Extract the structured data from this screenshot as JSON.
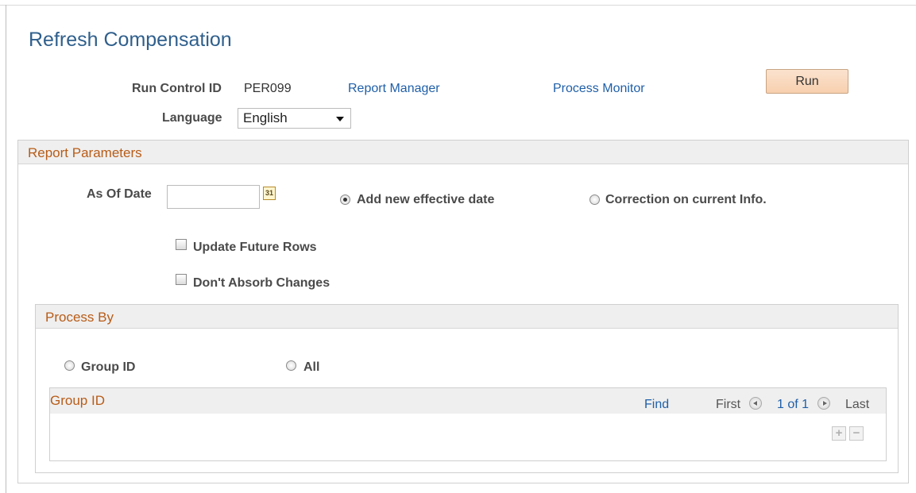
{
  "page": {
    "title": "Refresh Compensation"
  },
  "run_control": {
    "label": "Run Control ID",
    "value": "PER099",
    "report_manager": "Report Manager",
    "process_monitor": "Process Monitor",
    "run_label": "Run",
    "language_label": "Language",
    "language_value": "English"
  },
  "report_parameters": {
    "header": "Report Parameters",
    "as_of_date_label": "As Of Date",
    "as_of_date_value": "",
    "calendar_icon_text": "31",
    "option_add_new": "Add new effective date",
    "option_correction": "Correction on current Info.",
    "selected_option": "Add new effective date",
    "update_future_rows": "Update Future Rows",
    "dont_absorb_changes": "Don't Absorb Changes",
    "update_future_rows_checked": false,
    "dont_absorb_changes_checked": false
  },
  "process_by": {
    "header": "Process By",
    "option_group_id": "Group ID",
    "option_all": "All",
    "selected_option": null
  },
  "grid": {
    "title": "Group ID",
    "find": "Find",
    "first": "First",
    "range": "1 of 1",
    "last": "Last",
    "add_symbol": "+",
    "delete_symbol": "−"
  },
  "icons": {
    "calendar": "calendar-icon",
    "prev": "arrow-left-icon",
    "next": "arrow-right-icon",
    "add": "plus-icon",
    "delete": "minus-icon"
  },
  "colors": {
    "title": "#2f5f8c",
    "link": "#1f5fa8",
    "section_header": "#b85c17",
    "run_button": "#f7cfae"
  }
}
